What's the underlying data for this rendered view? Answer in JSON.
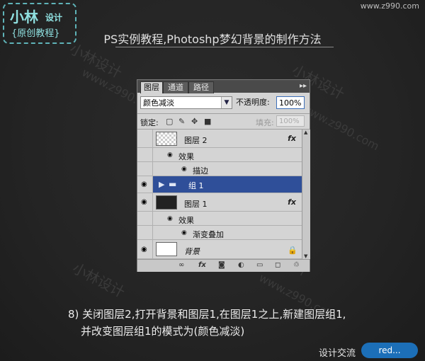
{
  "logo": {
    "line1": "小林",
    "line1b": "设计",
    "line2": "{原创教程}"
  },
  "site_url": "www.z990.com",
  "title": "PS实例教程,Photoshp梦幻背景的制作方法",
  "watermark": {
    "text1": "小林设计",
    "text2": "www.z990.com"
  },
  "panel": {
    "tabs": [
      {
        "label": "图层",
        "active": true
      },
      {
        "label": "通道",
        "active": false
      },
      {
        "label": "路径",
        "active": false
      }
    ],
    "menu_icon": "▸▸",
    "blend_mode": "颜色减淡",
    "opacity_label": "不透明度:",
    "opacity_value": "100%",
    "lock_label": "锁定:",
    "fill_label": "填充:",
    "fill_value": "100%",
    "layers": [
      {
        "name": "图层 2",
        "type": "layer",
        "thumb": "checker",
        "fx": "fx",
        "visible": false
      },
      {
        "name": "效果",
        "type": "effects"
      },
      {
        "name": "描边",
        "type": "effect"
      },
      {
        "name": "组 1",
        "type": "group",
        "selected": true,
        "visible": true
      },
      {
        "name": "图层 1",
        "type": "layer",
        "thumb": "dark",
        "fx": "fx",
        "visible": true
      },
      {
        "name": "效果",
        "type": "effects"
      },
      {
        "name": "渐变叠加",
        "type": "effect"
      },
      {
        "name": "背景",
        "type": "background",
        "thumb": "white",
        "visible": true
      }
    ]
  },
  "caption": {
    "line1": "8) 关闭图层2,打开背景和图层1,在图层1之上,新建图层组1,",
    "line2": "并改变图层组1的模式为(颜色减淡)"
  },
  "footer": {
    "text": "设计交流",
    "badge": "red..."
  },
  "colors": {
    "selected_row": "#2f4f99",
    "accent": "#5fb3b8"
  }
}
